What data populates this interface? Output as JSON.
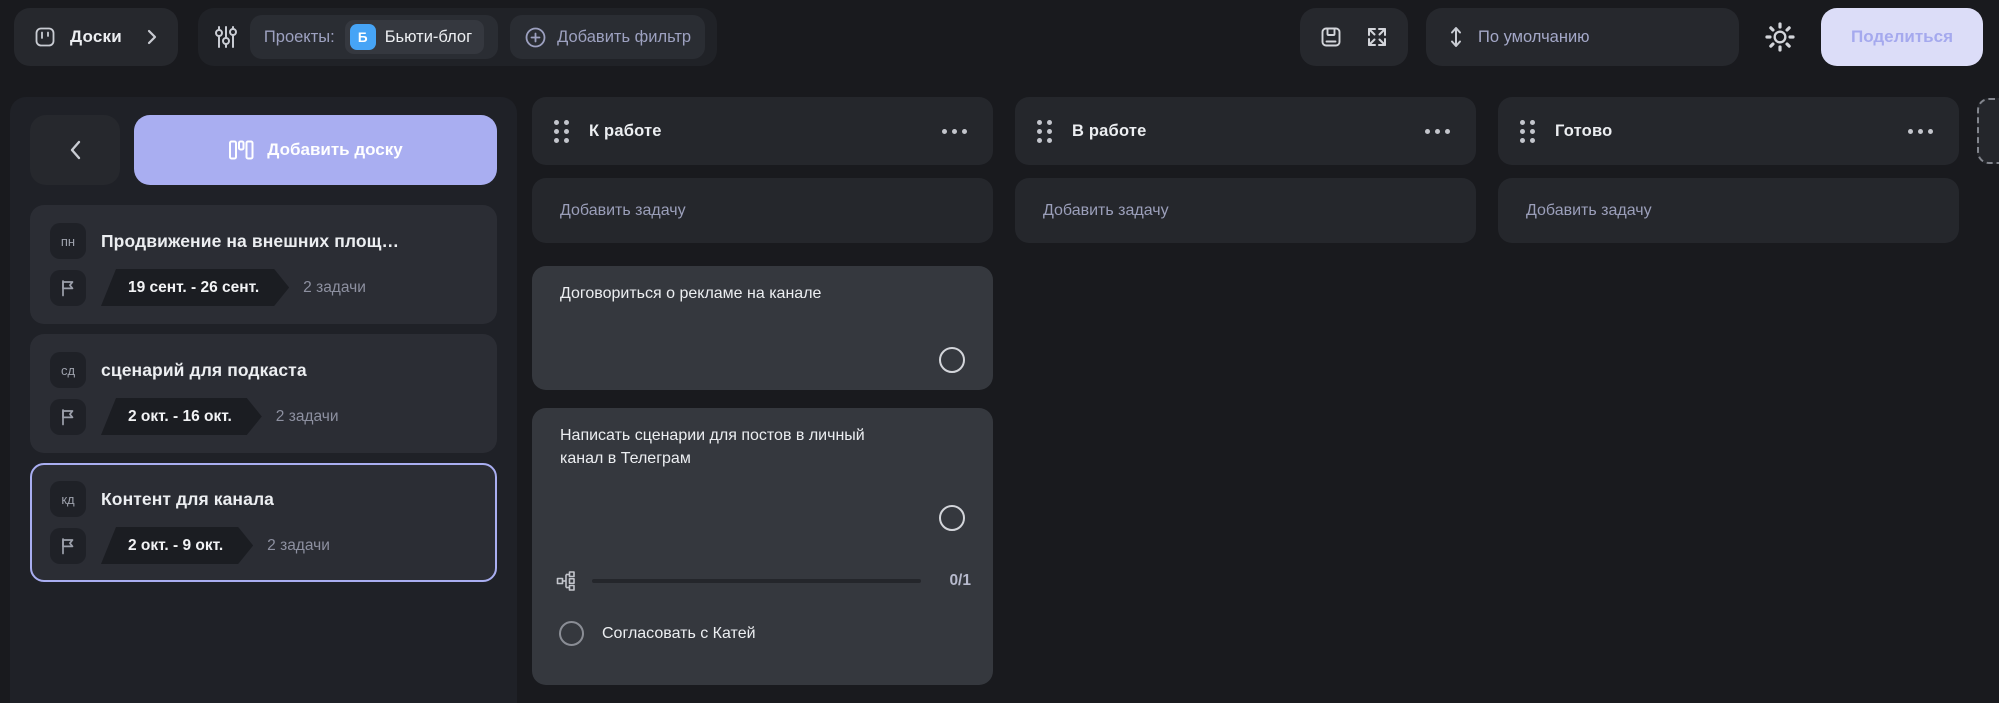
{
  "topbar": {
    "boards_label": "Доски",
    "filter": {
      "projects_label": "Проекты:",
      "project_badge": "Б",
      "project_name": "Бьюти-блог",
      "add_filter_label": "Добавить фильтр"
    },
    "sort_label": "По умолчанию",
    "share_label": "Поделиться"
  },
  "sidebar": {
    "add_board_label": "Добавить доску",
    "boards": [
      {
        "badge": "пн",
        "title": "Продвижение на внешних площ…",
        "dates": "19 сент. - 26 сент.",
        "tasks": "2 задачи"
      },
      {
        "badge": "сд",
        "title": "сценарий для подкаста",
        "dates": "2 окт. - 16 окт.",
        "tasks": "2 задачи"
      },
      {
        "badge": "кд",
        "title": "Контент для канала",
        "dates": "2 окт. - 9 окт.",
        "tasks": "2 задачи"
      }
    ]
  },
  "board": {
    "add_task_label": "Добавить задачу",
    "columns": [
      {
        "title": "К работе",
        "cards": [
          {
            "title": "Договориться о рекламе на канале"
          },
          {
            "title": "Написать сценарии для постов в личный канал в Телеграм",
            "progress": "0/1",
            "subtasks": [
              {
                "title": "Согласовать с Катей"
              }
            ]
          }
        ]
      },
      {
        "title": "В работе",
        "cards": []
      },
      {
        "title": "Готово",
        "cards": []
      }
    ]
  },
  "colors": {
    "accent": "#a9aef1",
    "project_badge": "#46a4f6",
    "share_bg": "#dcddf8",
    "share_text": "#a5a9ee",
    "card_bg": "#35383e",
    "panel_bg": "#1f2127"
  }
}
